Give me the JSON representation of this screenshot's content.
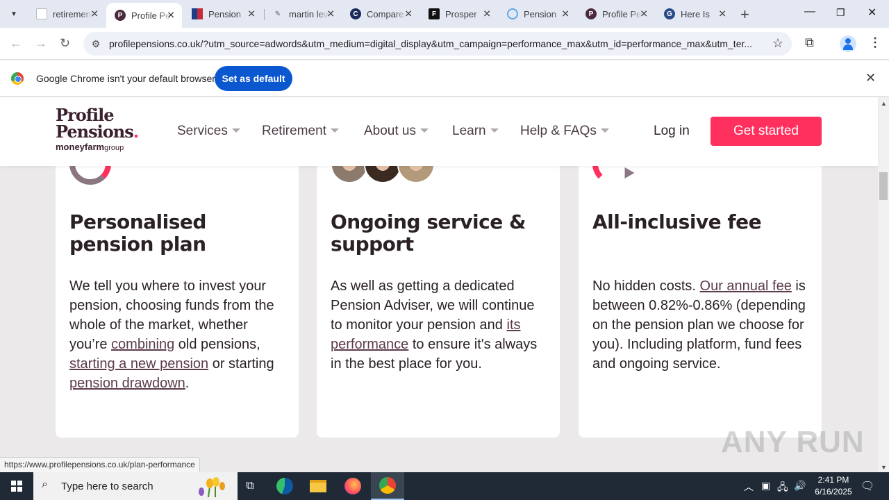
{
  "browser": {
    "tabs": [
      {
        "title": "retirement",
        "favicon": "blank-page",
        "active": false
      },
      {
        "title": "Profile Pensions",
        "favicon": "P",
        "active": true
      },
      {
        "title": "Pension",
        "favicon": "tiles",
        "active": false
      },
      {
        "title": "martin lewis",
        "favicon": "feather",
        "active": false
      },
      {
        "title": "Compare",
        "favicon": "C",
        "active": false
      },
      {
        "title": "Prosper",
        "favicon": "F",
        "active": false
      },
      {
        "title": "Pension",
        "favicon": "circle",
        "active": false
      },
      {
        "title": "Profile Pensions",
        "favicon": "P",
        "active": false
      },
      {
        "title": "Here Is",
        "favicon": "G",
        "active": false
      }
    ],
    "url": "profilepensions.co.uk/?utm_source=adwords&utm_medium=digital_display&utm_campaign=performance_max&utm_id=performance_max&utm_ter...",
    "infobar": {
      "message": "Google Chrome isn't your default browser",
      "button": "Set as default"
    },
    "status_url": "https://www.profilepensions.co.uk/plan-performance"
  },
  "site": {
    "logo": {
      "line1": "Profile",
      "line2": "Pensions",
      "dot": ".",
      "brand": "moneyfarm",
      "brand_suffix": "group"
    },
    "nav": [
      {
        "label": "Services"
      },
      {
        "label": "Retirement"
      },
      {
        "label": "About us"
      },
      {
        "label": "Learn"
      },
      {
        "label": "Help & FAQs"
      }
    ],
    "login": "Log in",
    "cta": "Get started",
    "accent_color": "#ff2f5e",
    "cards": [
      {
        "title": "Personalised pension plan",
        "body": [
          {
            "t": "We tell you where to invest your pension, choosing funds from the whole of the market, whether you’re "
          },
          {
            "t": "combining",
            "link": true
          },
          {
            "t": " old pensions, "
          },
          {
            "t": "starting a new pension",
            "link": true
          },
          {
            "t": " or starting "
          },
          {
            "t": "pension drawdown",
            "link": true
          },
          {
            "t": "."
          }
        ]
      },
      {
        "title": "Ongoing service & support",
        "body": [
          {
            "t": "As well as getting a dedicated Pension Adviser, we will continue to monitor your pension and "
          },
          {
            "t": "its performance",
            "link": true
          },
          {
            "t": " to ensure it's always in the best place for you."
          }
        ]
      },
      {
        "title": "All-inclusive fee",
        "body": [
          {
            "t": "No hidden costs. "
          },
          {
            "t": "Our annual fee",
            "link": true
          },
          {
            "t": " is between 0.82%-0.86% (depending on the pension plan we choose for you). Including platform, fund fees and ongoing service."
          }
        ]
      }
    ]
  },
  "watermark": "ANY RUN",
  "taskbar": {
    "search_placeholder": "Type here to search",
    "time": "2:41 PM",
    "date": "6/16/2025"
  }
}
